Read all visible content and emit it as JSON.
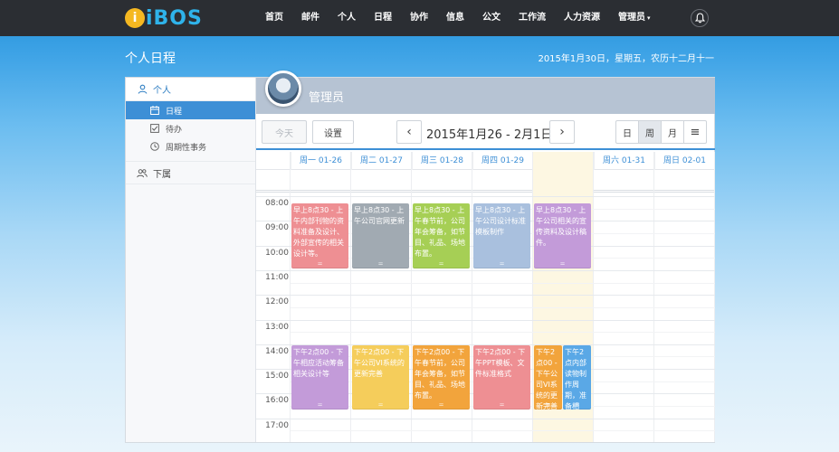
{
  "app": {
    "logo_badge": "i",
    "logo_text": "iBOS",
    "nav": [
      "首页",
      "邮件",
      "个人",
      "日程",
      "协作",
      "信息",
      "公文",
      "工作流",
      "人力资源",
      "管理员"
    ],
    "nav_caret": "▾"
  },
  "header": {
    "title": "个人日程",
    "date": "2015年1月30日，星期五，农历十二月十一"
  },
  "sidebar": {
    "group_personal": "个人",
    "items": [
      "日程",
      "待办",
      "周期性事务"
    ],
    "group_sub": "下属"
  },
  "user": {
    "name": "管理员"
  },
  "toolbar": {
    "today": "今天",
    "settings": "设置",
    "prev": "‹",
    "next": "›",
    "range": "2015年1月26 - 2月1日",
    "view_day": "日",
    "view_week": "周",
    "view_month": "月",
    "view_list": "≡"
  },
  "calendar": {
    "days": [
      "周一 01-26",
      "周二 01-27",
      "周三 01-28",
      "周四 01-29",
      "周五 01-30",
      "周六 01-31",
      "周日 02-01"
    ],
    "times": [
      "08:00",
      "09:00",
      "10:00",
      "11:00",
      "12:00",
      "13:00",
      "14:00",
      "15:00",
      "16:00",
      "17:00"
    ],
    "today_index": 4,
    "events": [
      {
        "day": 0,
        "start": 8.25,
        "end": 10.9,
        "color": "#ee8f93",
        "text": "早上8点30 - 上午内部刊物的资料准备及设计、外部宣传的相关设计等。"
      },
      {
        "day": 1,
        "start": 8.25,
        "end": 10.9,
        "color": "#a1aab2",
        "text": "早上8点30 - 上午公司官网更新"
      },
      {
        "day": 2,
        "start": 8.25,
        "end": 10.9,
        "color": "#a6cf55",
        "text": "早上8点30 - 上午春节前，公司年会筹备，如节目、礼品、场地布置。"
      },
      {
        "day": 3,
        "start": 8.25,
        "end": 10.9,
        "color": "#a9c0de",
        "text": "早上8点30 - 上午公司设计标准模板制作"
      },
      {
        "day": 4,
        "start": 8.25,
        "end": 10.9,
        "color": "#c39bd9",
        "text": "早上8点30 - 上午公司相关的宣传资料及设计稿件。"
      },
      {
        "day": 0,
        "start": 14.0,
        "end": 16.6,
        "color": "#c39bd9",
        "text": "下午2点00 - 下午相应活动筹备相关设计等"
      },
      {
        "day": 1,
        "start": 14.0,
        "end": 16.6,
        "color": "#f5cd5b",
        "text": "下午2点00 - 下午公司VI系统的更新完善"
      },
      {
        "day": 2,
        "start": 14.0,
        "end": 16.6,
        "color": "#f2a43c",
        "text": "下午2点00 - 下午春节前，公司年会筹备，如节目、礼品、场地布置。"
      },
      {
        "day": 3,
        "start": 14.0,
        "end": 16.6,
        "color": "#ee8f93",
        "text": "下午2点00 - 下午PPT模板、文件标准格式"
      },
      {
        "day": 4,
        "start": 14.0,
        "end": 16.6,
        "color": "#f2a43c",
        "text": "下午2点00 - 下午公司VI系统的更新完善",
        "half": "left"
      },
      {
        "day": 4,
        "start": 14.0,
        "end": 16.6,
        "color": "#5aa8e6",
        "text": "下午2点内部读物制作周期，准备相",
        "half": "right"
      }
    ]
  },
  "colors": {
    "topbar": "#2b2e33",
    "accent": "#3d8fd6",
    "today_bg": "#fdf7e2",
    "user_bar": "#b6c3d3"
  }
}
